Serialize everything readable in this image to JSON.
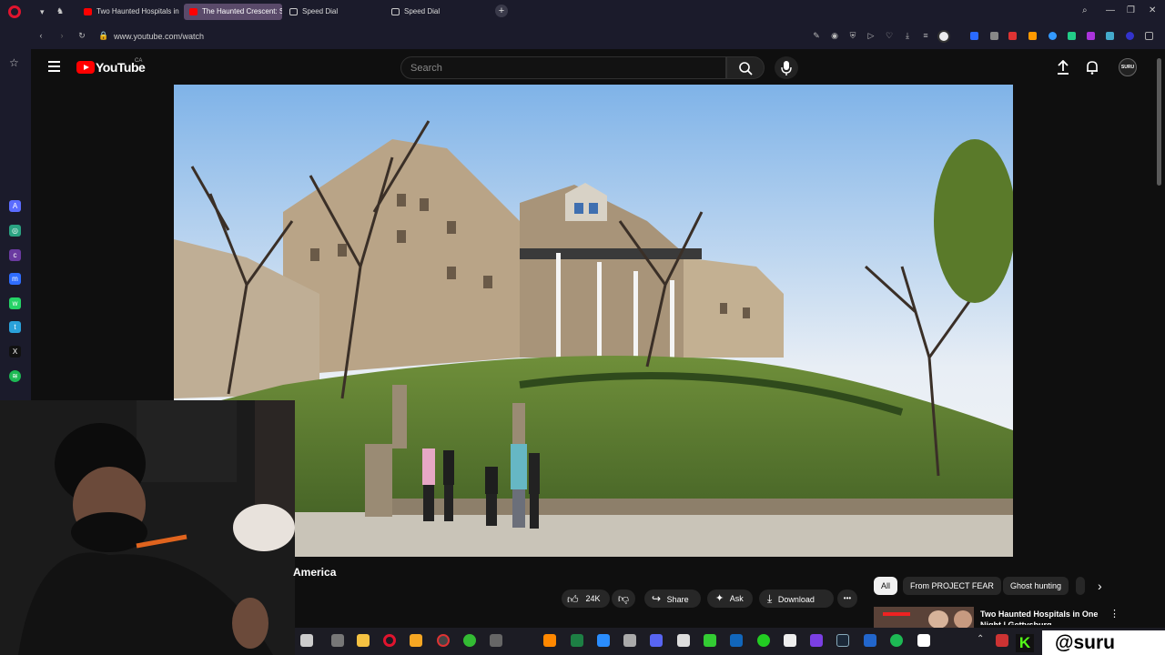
{
  "browser": {
    "tabs": [
      {
        "title": "Two Haunted Hospitals in",
        "active": false
      },
      {
        "title": "The Haunted Crescent: Sc",
        "active": true
      },
      {
        "title": "Speed Dial",
        "active": false
      },
      {
        "title": "Speed Dial",
        "active": false
      }
    ],
    "new_tab": "+",
    "url": "www.youtube.com/watch"
  },
  "youtube": {
    "logo_text": "YouTube",
    "country": "CA",
    "search_placeholder": "Search",
    "avatar_text": "SURU"
  },
  "video": {
    "title": "America",
    "like_count": "24K",
    "share_label": "Share",
    "ask_label": "Ask",
    "download_label": "Download",
    "more_label": "•••"
  },
  "chips": [
    "All",
    "From PROJECT FEAR",
    "Ghost hunting"
  ],
  "suggestion": {
    "title": "Two Haunted Hospitals in One Night | Gettysburg"
  },
  "overlay": {
    "handle": "@suru",
    "kick_letter": "K"
  },
  "colors": {
    "accent": "#ff0000",
    "background": "#0f0f0f",
    "browser_chrome": "#1b1b2b"
  }
}
